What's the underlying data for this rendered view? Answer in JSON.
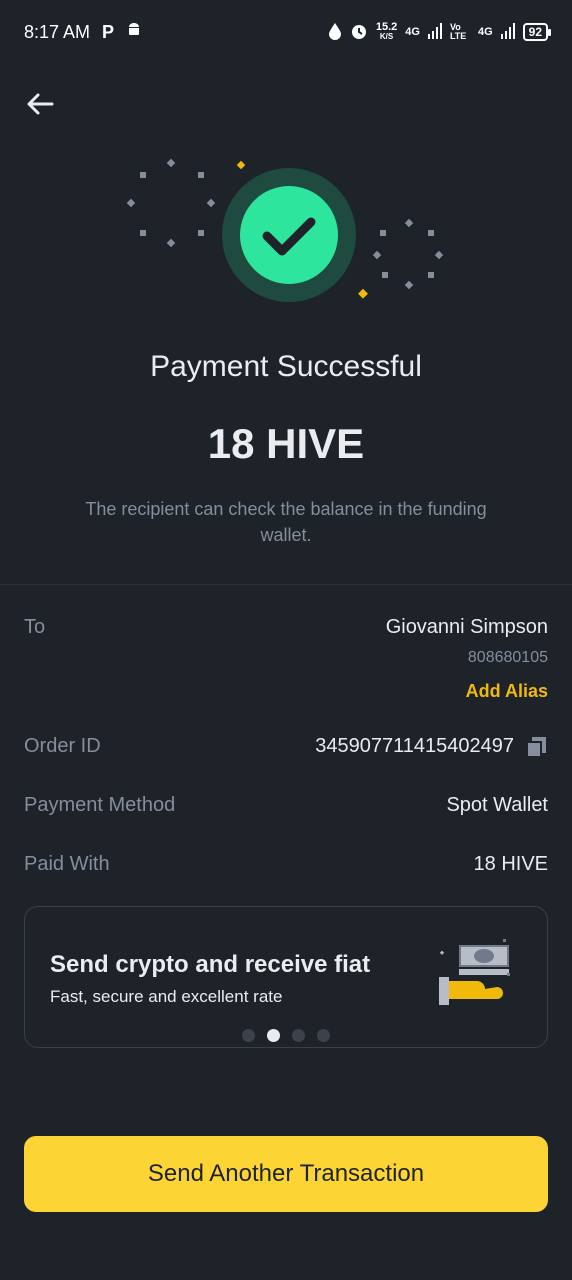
{
  "status_bar": {
    "time": "8:17 AM",
    "app_badge": "P",
    "speed_value": "15.2",
    "speed_unit": "K/S",
    "net1": "4G",
    "volte": "Vo LTE",
    "net2": "4G",
    "battery": "92"
  },
  "header": {
    "back_icon": "arrow-left-icon"
  },
  "result": {
    "title": "Payment Successful",
    "amount": "18 HIVE",
    "subtitle": "The recipient can check the balance in the funding wallet.",
    "accent_color": "#2ee59d"
  },
  "details": {
    "to_label": "To",
    "to_name": "Giovanni Simpson",
    "to_id": "808680105",
    "add_alias": "Add Alias",
    "order_label": "Order ID",
    "order_value": "345907711415402497",
    "method_label": "Payment Method",
    "method_value": "Spot Wallet",
    "paid_label": "Paid With",
    "paid_value": "18 HIVE"
  },
  "promo": {
    "title": "Send crypto and receive fiat",
    "subtitle": "Fast, secure and excellent rate",
    "page_count": 4,
    "active_page": 2
  },
  "cta": {
    "label": "Send Another Transaction",
    "color": "#fcd535"
  }
}
